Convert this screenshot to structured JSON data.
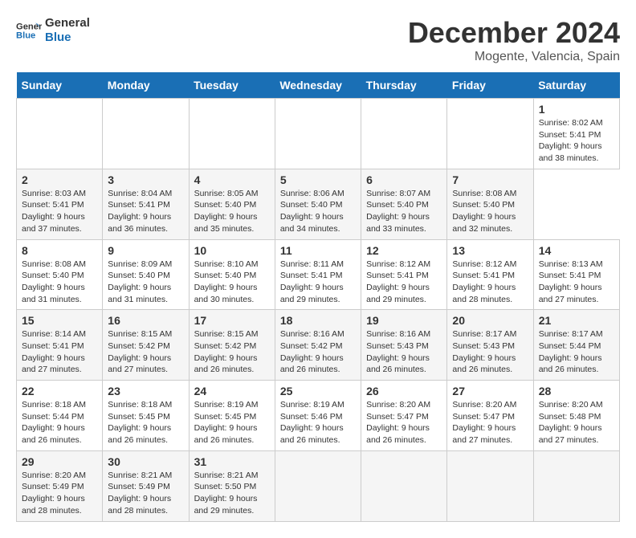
{
  "header": {
    "logo_line1": "General",
    "logo_line2": "Blue",
    "title": "December 2024",
    "subtitle": "Mogente, Valencia, Spain"
  },
  "calendar": {
    "days_of_week": [
      "Sunday",
      "Monday",
      "Tuesday",
      "Wednesday",
      "Thursday",
      "Friday",
      "Saturday"
    ],
    "weeks": [
      [
        null,
        null,
        null,
        null,
        null,
        null,
        {
          "day": 1,
          "sunrise": "Sunrise: 8:02 AM",
          "sunset": "Sunset: 5:41 PM",
          "daylight": "Daylight: 9 hours and 38 minutes."
        }
      ],
      [
        {
          "day": 2,
          "sunrise": "Sunrise: 8:03 AM",
          "sunset": "Sunset: 5:41 PM",
          "daylight": "Daylight: 9 hours and 37 minutes."
        },
        {
          "day": 3,
          "sunrise": "Sunrise: 8:04 AM",
          "sunset": "Sunset: 5:41 PM",
          "daylight": "Daylight: 9 hours and 36 minutes."
        },
        {
          "day": 4,
          "sunrise": "Sunrise: 8:05 AM",
          "sunset": "Sunset: 5:40 PM",
          "daylight": "Daylight: 9 hours and 35 minutes."
        },
        {
          "day": 5,
          "sunrise": "Sunrise: 8:06 AM",
          "sunset": "Sunset: 5:40 PM",
          "daylight": "Daylight: 9 hours and 34 minutes."
        },
        {
          "day": 6,
          "sunrise": "Sunrise: 8:07 AM",
          "sunset": "Sunset: 5:40 PM",
          "daylight": "Daylight: 9 hours and 33 minutes."
        },
        {
          "day": 7,
          "sunrise": "Sunrise: 8:08 AM",
          "sunset": "Sunset: 5:40 PM",
          "daylight": "Daylight: 9 hours and 32 minutes."
        }
      ],
      [
        {
          "day": 8,
          "sunrise": "Sunrise: 8:08 AM",
          "sunset": "Sunset: 5:40 PM",
          "daylight": "Daylight: 9 hours and 31 minutes."
        },
        {
          "day": 9,
          "sunrise": "Sunrise: 8:09 AM",
          "sunset": "Sunset: 5:40 PM",
          "daylight": "Daylight: 9 hours and 31 minutes."
        },
        {
          "day": 10,
          "sunrise": "Sunrise: 8:10 AM",
          "sunset": "Sunset: 5:40 PM",
          "daylight": "Daylight: 9 hours and 30 minutes."
        },
        {
          "day": 11,
          "sunrise": "Sunrise: 8:11 AM",
          "sunset": "Sunset: 5:41 PM",
          "daylight": "Daylight: 9 hours and 29 minutes."
        },
        {
          "day": 12,
          "sunrise": "Sunrise: 8:12 AM",
          "sunset": "Sunset: 5:41 PM",
          "daylight": "Daylight: 9 hours and 29 minutes."
        },
        {
          "day": 13,
          "sunrise": "Sunrise: 8:12 AM",
          "sunset": "Sunset: 5:41 PM",
          "daylight": "Daylight: 9 hours and 28 minutes."
        },
        {
          "day": 14,
          "sunrise": "Sunrise: 8:13 AM",
          "sunset": "Sunset: 5:41 PM",
          "daylight": "Daylight: 9 hours and 27 minutes."
        }
      ],
      [
        {
          "day": 15,
          "sunrise": "Sunrise: 8:14 AM",
          "sunset": "Sunset: 5:41 PM",
          "daylight": "Daylight: 9 hours and 27 minutes."
        },
        {
          "day": 16,
          "sunrise": "Sunrise: 8:15 AM",
          "sunset": "Sunset: 5:42 PM",
          "daylight": "Daylight: 9 hours and 27 minutes."
        },
        {
          "day": 17,
          "sunrise": "Sunrise: 8:15 AM",
          "sunset": "Sunset: 5:42 PM",
          "daylight": "Daylight: 9 hours and 26 minutes."
        },
        {
          "day": 18,
          "sunrise": "Sunrise: 8:16 AM",
          "sunset": "Sunset: 5:42 PM",
          "daylight": "Daylight: 9 hours and 26 minutes."
        },
        {
          "day": 19,
          "sunrise": "Sunrise: 8:16 AM",
          "sunset": "Sunset: 5:43 PM",
          "daylight": "Daylight: 9 hours and 26 minutes."
        },
        {
          "day": 20,
          "sunrise": "Sunrise: 8:17 AM",
          "sunset": "Sunset: 5:43 PM",
          "daylight": "Daylight: 9 hours and 26 minutes."
        },
        {
          "day": 21,
          "sunrise": "Sunrise: 8:17 AM",
          "sunset": "Sunset: 5:44 PM",
          "daylight": "Daylight: 9 hours and 26 minutes."
        }
      ],
      [
        {
          "day": 22,
          "sunrise": "Sunrise: 8:18 AM",
          "sunset": "Sunset: 5:44 PM",
          "daylight": "Daylight: 9 hours and 26 minutes."
        },
        {
          "day": 23,
          "sunrise": "Sunrise: 8:18 AM",
          "sunset": "Sunset: 5:45 PM",
          "daylight": "Daylight: 9 hours and 26 minutes."
        },
        {
          "day": 24,
          "sunrise": "Sunrise: 8:19 AM",
          "sunset": "Sunset: 5:45 PM",
          "daylight": "Daylight: 9 hours and 26 minutes."
        },
        {
          "day": 25,
          "sunrise": "Sunrise: 8:19 AM",
          "sunset": "Sunset: 5:46 PM",
          "daylight": "Daylight: 9 hours and 26 minutes."
        },
        {
          "day": 26,
          "sunrise": "Sunrise: 8:20 AM",
          "sunset": "Sunset: 5:47 PM",
          "daylight": "Daylight: 9 hours and 26 minutes."
        },
        {
          "day": 27,
          "sunrise": "Sunrise: 8:20 AM",
          "sunset": "Sunset: 5:47 PM",
          "daylight": "Daylight: 9 hours and 27 minutes."
        },
        {
          "day": 28,
          "sunrise": "Sunrise: 8:20 AM",
          "sunset": "Sunset: 5:48 PM",
          "daylight": "Daylight: 9 hours and 27 minutes."
        }
      ],
      [
        {
          "day": 29,
          "sunrise": "Sunrise: 8:20 AM",
          "sunset": "Sunset: 5:49 PM",
          "daylight": "Daylight: 9 hours and 28 minutes."
        },
        {
          "day": 30,
          "sunrise": "Sunrise: 8:21 AM",
          "sunset": "Sunset: 5:49 PM",
          "daylight": "Daylight: 9 hours and 28 minutes."
        },
        {
          "day": 31,
          "sunrise": "Sunrise: 8:21 AM",
          "sunset": "Sunset: 5:50 PM",
          "daylight": "Daylight: 9 hours and 29 minutes."
        },
        null,
        null,
        null,
        null
      ]
    ]
  }
}
